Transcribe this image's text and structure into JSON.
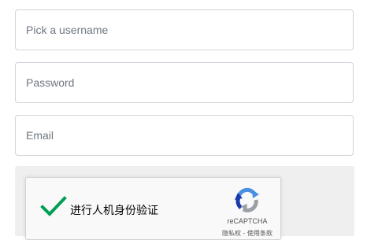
{
  "form": {
    "username": {
      "placeholder": "Pick a username",
      "value": ""
    },
    "password": {
      "placeholder": "Password",
      "value": ""
    },
    "email": {
      "placeholder": "Email",
      "value": ""
    }
  },
  "recaptcha": {
    "checked": true,
    "label": "进行人机身份验证",
    "brand": "reCAPTCHA",
    "privacy": "隐私权",
    "separator": " - ",
    "terms": "使用条款",
    "colors": {
      "check": "#009e55",
      "logo_blue": "#4a90e2",
      "logo_gray": "#9aa0a6"
    }
  }
}
